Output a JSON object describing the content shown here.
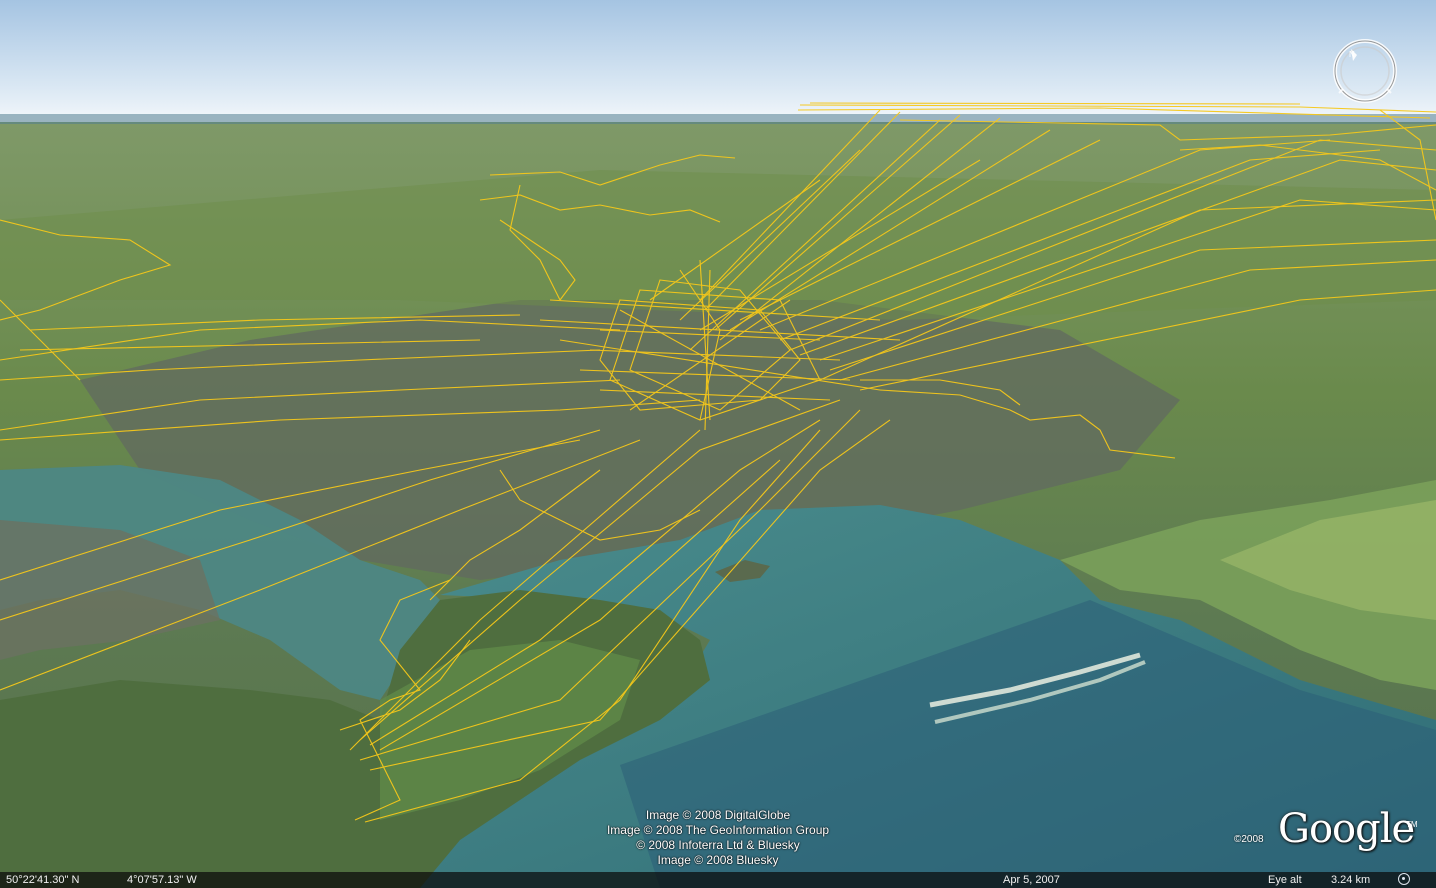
{
  "colors": {
    "sky_top": "#a9c7e4",
    "sky_horizon": "#f0f5fa",
    "land": "#6f8f55",
    "water": "#3e7f86",
    "track": "#f6c81a"
  },
  "credits": [
    "Image © 2008 DigitalGlobe",
    "Image © 2008 The GeoInformation Group",
    "© 2008 Infoterra Ltd & Bluesky",
    "Image © 2008 Bluesky"
  ],
  "logo": {
    "year": "©2008",
    "word": "Google",
    "tm": "TM"
  },
  "status": {
    "latitude": "50°22'41.30\" N",
    "longitude": "4°07'57.13\" W",
    "date": "Apr  5, 2007",
    "eye_alt_label": "Eye alt",
    "eye_alt_value": "3.24 km"
  },
  "icons": {
    "compass": "navigation-compass-icon",
    "streaming": "streaming-indicator-icon"
  }
}
